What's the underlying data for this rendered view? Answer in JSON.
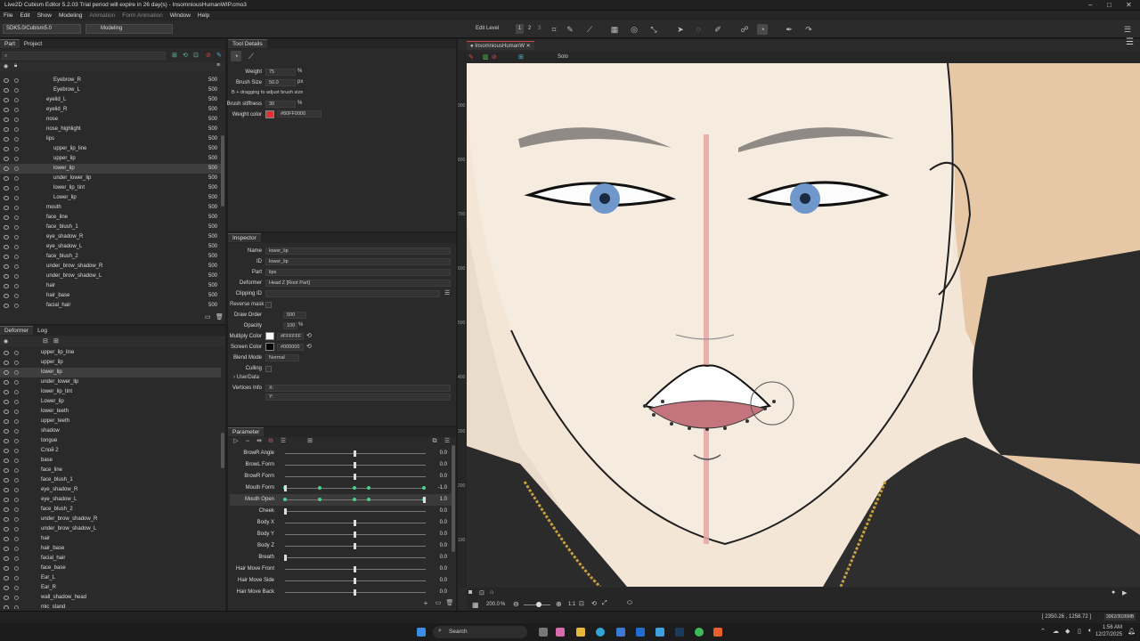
{
  "titlebar": {
    "title": "Live2D Cubism Editor 5.2.03   Trial period will expire in 26 day(s)  -  InsomniousHumanWIP.cmo3"
  },
  "menu": [
    "File",
    "Edit",
    "Show",
    "Modeling",
    "Animation",
    "Form Animation",
    "Window",
    "Help"
  ],
  "toolbar": {
    "sdk": "SDK5.0/Cubism5.0",
    "mode": "Modeling",
    "edit_level": "Edit Level",
    "levels": [
      "1",
      "2",
      "3"
    ]
  },
  "part_panel": {
    "tabs": [
      "Part",
      "Project"
    ],
    "rows": [
      {
        "name": "Eyebrow_R",
        "v": "500",
        "i": 1
      },
      {
        "name": "Eyebrow_L",
        "v": "500",
        "i": 1
      },
      {
        "name": "eyelid_L",
        "v": "500",
        "i": 0
      },
      {
        "name": "eyelid_R",
        "v": "500",
        "i": 0
      },
      {
        "name": "nose",
        "v": "500",
        "i": 0
      },
      {
        "name": "nose_highlight",
        "v": "500",
        "i": 0
      },
      {
        "name": "lips",
        "v": "500",
        "i": 0
      },
      {
        "name": "upper_lip_line",
        "v": "500",
        "i": 1
      },
      {
        "name": "upper_lip",
        "v": "500",
        "i": 1
      },
      {
        "name": "lower_lip",
        "v": "500",
        "i": 1
      },
      {
        "name": "under_lower_lip",
        "v": "500",
        "i": 1
      },
      {
        "name": "lower_lip_tint",
        "v": "500",
        "i": 1
      },
      {
        "name": "Lower_lip",
        "v": "500",
        "i": 1
      },
      {
        "name": "mouth",
        "v": "500",
        "i": 0
      },
      {
        "name": "face_line",
        "v": "500",
        "i": 0
      },
      {
        "name": "face_blush_1",
        "v": "500",
        "i": 0
      },
      {
        "name": "eye_shadow_R",
        "v": "500",
        "i": 0
      },
      {
        "name": "eye_shadow_L",
        "v": "500",
        "i": 0
      },
      {
        "name": "face_blush_2",
        "v": "500",
        "i": 0
      },
      {
        "name": "under_brow_shadow_R",
        "v": "500",
        "i": 0
      },
      {
        "name": "under_brow_shadow_L",
        "v": "500",
        "i": 0
      },
      {
        "name": "hair",
        "v": "500",
        "i": 0
      },
      {
        "name": "hair_base",
        "v": "500",
        "i": 0
      },
      {
        "name": "facial_hair",
        "v": "500",
        "i": 0
      }
    ]
  },
  "deformer_panel": {
    "tabs": [
      "Deformer",
      "Log"
    ],
    "rows": [
      "upper_lip_line",
      "upper_lip",
      "lower_lip",
      "under_lower_lip",
      "lower_lip_tint",
      "Lower_lip",
      "lower_teeth",
      "upper_teeth",
      "shadow",
      "tongue",
      "Слой 2",
      "base",
      "face_line",
      "face_blush_1",
      "eye_shadow_R",
      "eye_shadow_L",
      "face_blush_2",
      "under_brow_shadow_R",
      "under_brow_shadow_L",
      "hair",
      "hair_base",
      "facial_hair",
      "face_base",
      "Ear_L",
      "Ear_R",
      "wall_shadow_head",
      "mic_stand"
    ]
  },
  "tool_details": {
    "tab": "Tool Details",
    "weight_label": "Weight",
    "weight": "75",
    "pct": "%",
    "brush_size_label": "Brush Size",
    "brush_size": "50.0",
    "px": "px",
    "hint": "B + dragging to adjust brush size",
    "stiffness_label": "Brush stiffness",
    "stiffness": "30",
    "weight_color_label": "Weight color",
    "weight_color": "#FF0000",
    "weight_color_text": "#80FF0000"
  },
  "inspector": {
    "tab": "Inspector",
    "name_label": "Name",
    "name": "lower_lip",
    "id_label": "ID",
    "id": "lower_lip",
    "part_label": "Part",
    "part": "lips",
    "deformer_label": "Deformer",
    "deformer": "Head Z  [Root Part]",
    "clip_label": "Clipping ID",
    "reverse_label": "Reverse mask",
    "draw_order_label": "Draw Order",
    "draw_order": "500",
    "opacity_label": "Opacity",
    "opacity": "100",
    "multiply_label": "Multiply Color",
    "multiply": "#FFFFFF",
    "screen_label": "Screen Color",
    "screen": "#000000",
    "blend_label": "Blend Mode",
    "blend": "Normal",
    "culling_label": "Culling",
    "userdata_label": "UserData",
    "vertices_label": "Vertices Info",
    "vx": "X:",
    "vy": "Y:"
  },
  "parameter": {
    "tab": "Parameter",
    "rows": [
      {
        "name": "BrowR Angle",
        "value": "0.0",
        "pos": 0.5
      },
      {
        "name": "BrowL Form",
        "value": "0.0",
        "pos": 0.5
      },
      {
        "name": "BrowR Form",
        "value": "0.0",
        "pos": 0.5
      },
      {
        "name": "Mouth Form",
        "value": "-1.0",
        "pos": 0.0
      },
      {
        "name": "Mouth Open",
        "value": "1.0",
        "pos": 1.0
      },
      {
        "name": "Cheek",
        "value": "0.0",
        "pos": 0.0
      },
      {
        "name": "Body X",
        "value": "0.0",
        "pos": 0.5
      },
      {
        "name": "Body Y",
        "value": "0.0",
        "pos": 0.5
      },
      {
        "name": "Body Z",
        "value": "0.0",
        "pos": 0.5
      },
      {
        "name": "Breath",
        "value": "0.0",
        "pos": 0.0
      },
      {
        "name": "Hair Move Front",
        "value": "0.0",
        "pos": 0.5
      },
      {
        "name": "Hair Move Side",
        "value": "0.0",
        "pos": 0.5
      },
      {
        "name": "Hair Move Back",
        "value": "0.0",
        "pos": 0.5
      }
    ]
  },
  "view": {
    "tab": "InsomniousHumanW",
    "solo": "Solo",
    "zoom": "200.0",
    "zoom_unit": "%",
    "ratio": "1:1"
  },
  "ruler": [
    "900",
    "800",
    "700",
    "600",
    "500",
    "400",
    "300",
    "200",
    "100"
  ],
  "status": {
    "coords": "[ 2350.26 , 1258.72 ]",
    "size": "3062/3026MB"
  },
  "taskbar": {
    "search": "Search",
    "time": "1:56 AM",
    "date": "12/27/2025"
  }
}
